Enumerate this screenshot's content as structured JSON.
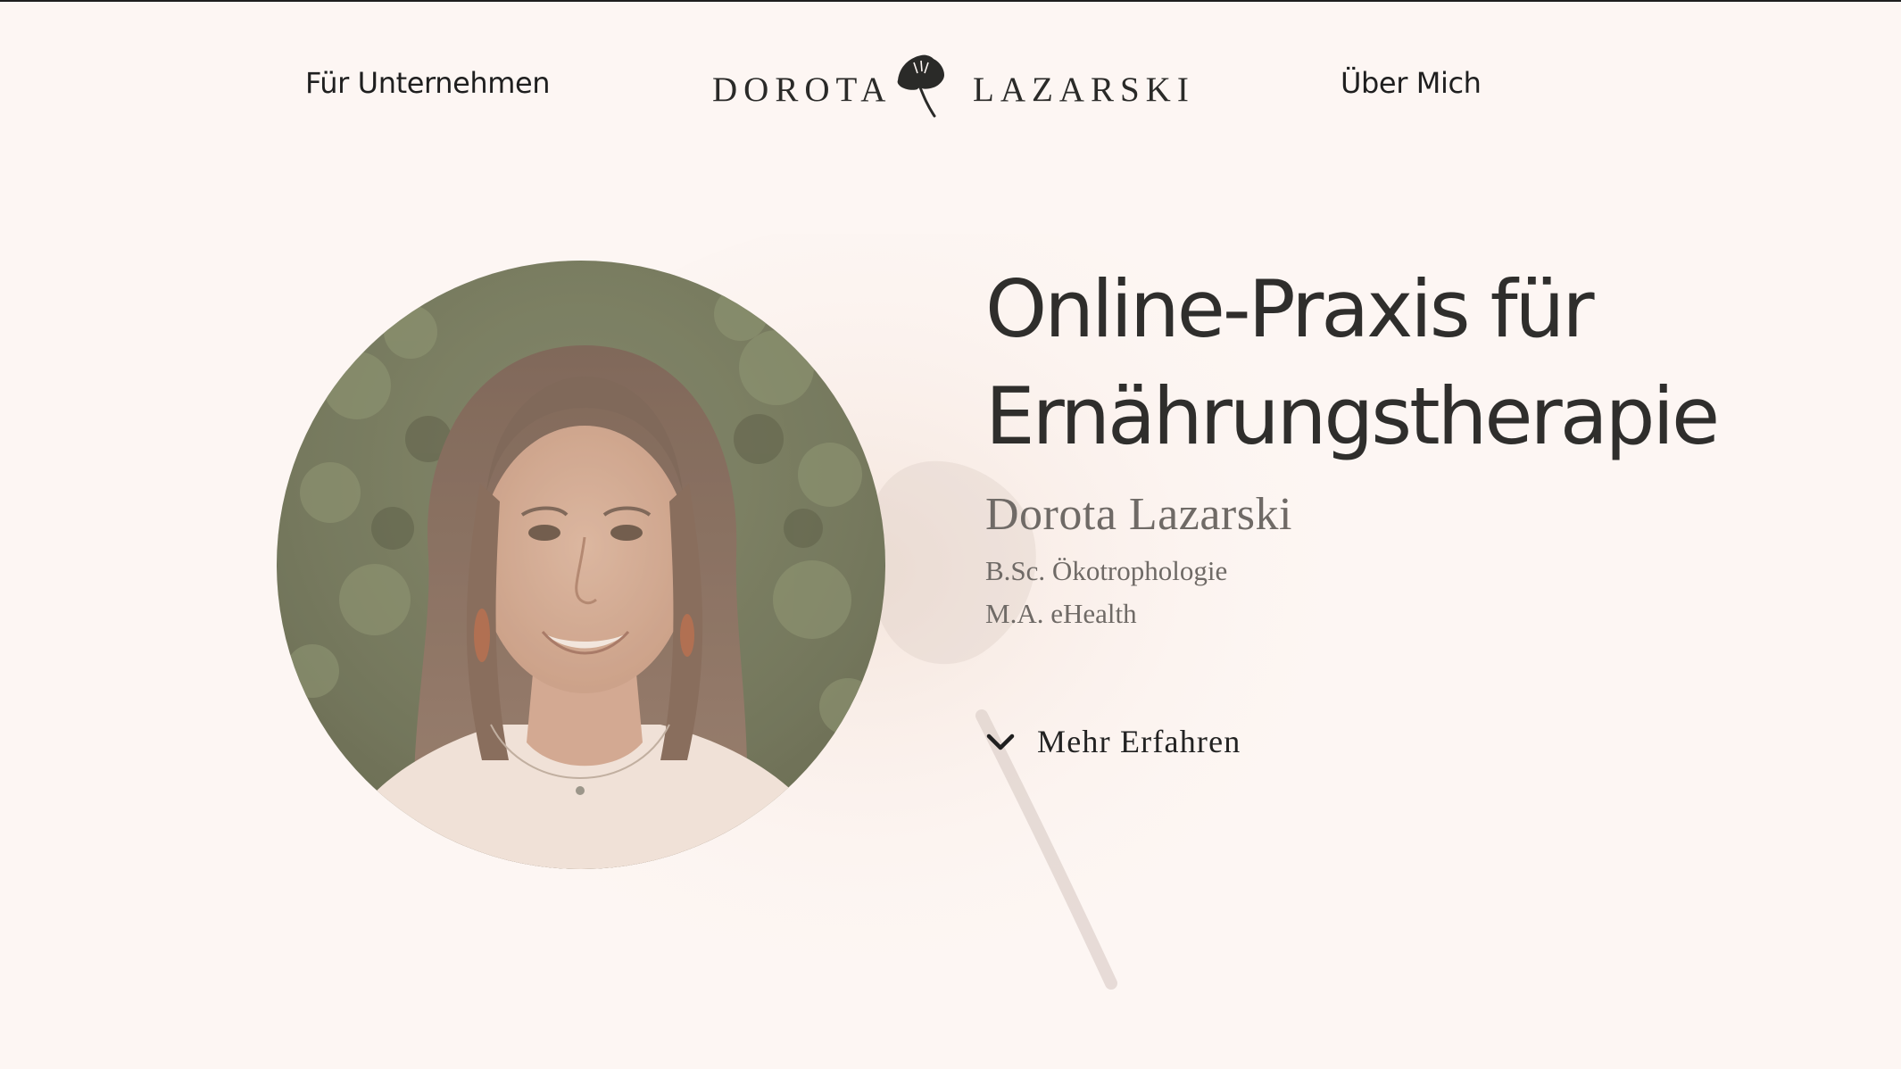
{
  "header": {
    "nav_left": "Für Unternehmen",
    "nav_right": "Über Mich",
    "brand_first": "DOROTA",
    "brand_last": "LAZARSKI",
    "brand_icon": "ginkgo-leaf-icon"
  },
  "hero": {
    "title_line1": "Online-Praxis für",
    "title_line2": "Ernährungstherapie",
    "name": "Dorota Lazarski",
    "degree1": "B.Sc. Ökotrophologie",
    "degree2": "M.A. eHealth",
    "more_label": "Mehr Erfahren",
    "more_icon": "chevron-down-icon"
  },
  "colors": {
    "background": "#fdf6f3",
    "text": "#2f2e2c",
    "muted": "#6f6a66"
  }
}
